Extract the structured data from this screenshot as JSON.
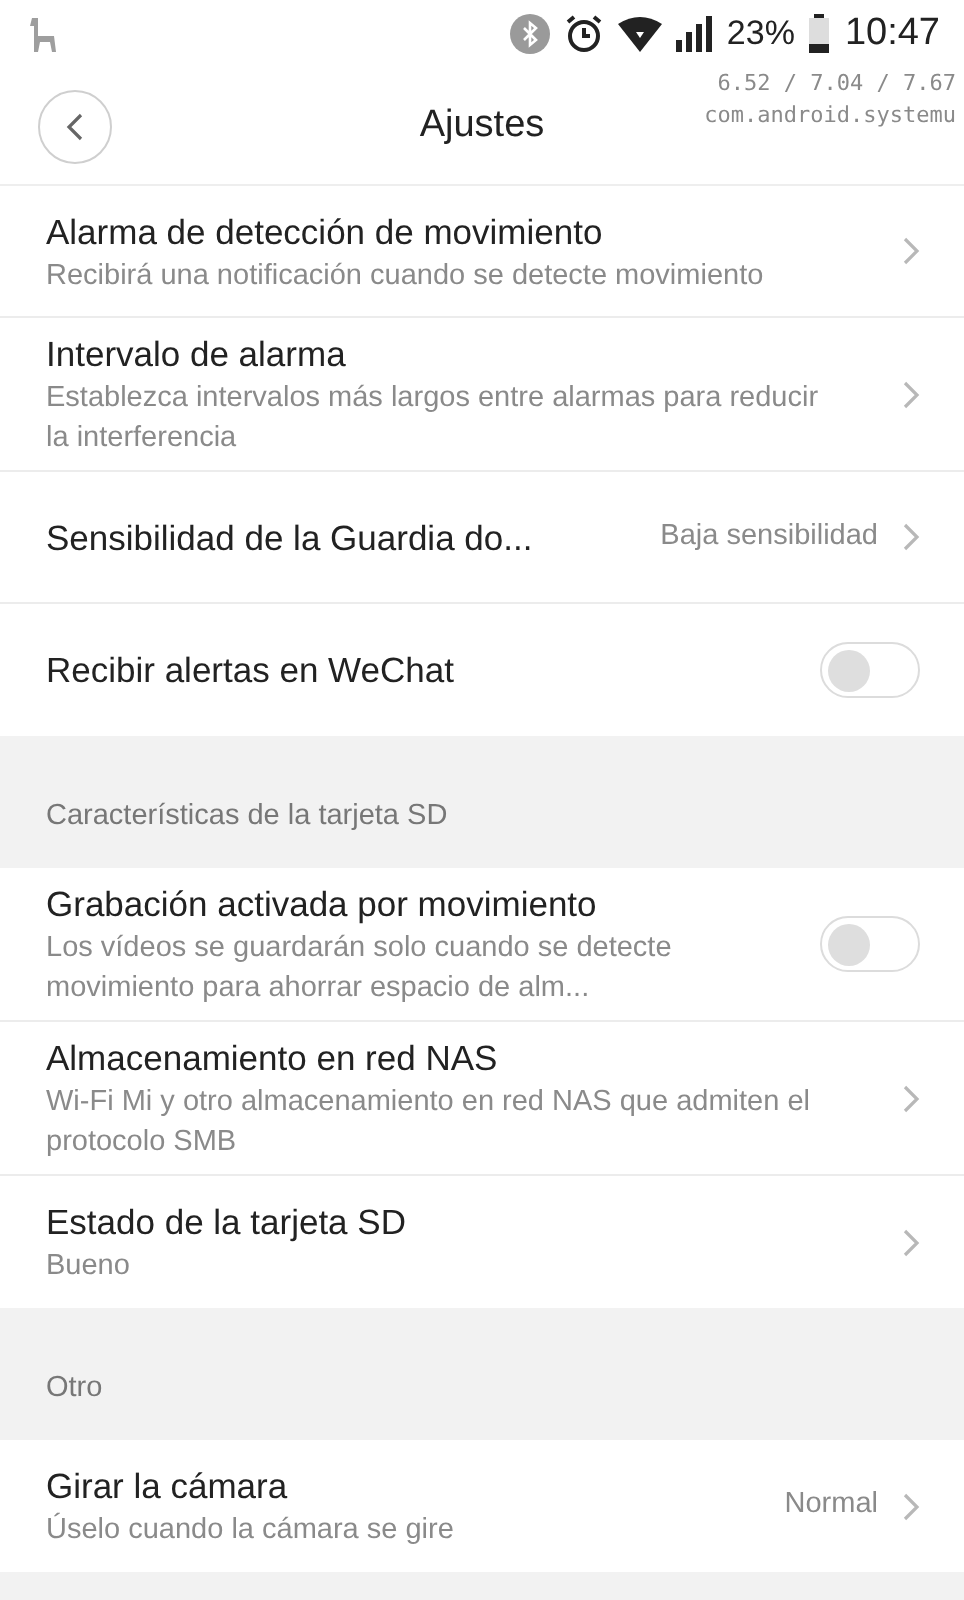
{
  "status_bar": {
    "battery": "23%",
    "time": "10:47"
  },
  "overlay": {
    "load": "6.52 / 7.04 / 7.67",
    "process": "com.android.systemu"
  },
  "header": {
    "title": "Ajustes"
  },
  "sections": [
    {
      "items": [
        {
          "kind": "nav",
          "title": "Alarma de detección de movimiento",
          "subtitle": "Recibirá una notificación cuando se detecte movimiento"
        },
        {
          "kind": "nav",
          "title": "Intervalo de alarma",
          "subtitle": "Establezca intervalos más largos entre alarmas para reducir la interferencia"
        },
        {
          "kind": "nav",
          "title": "Sensibilidad de la Guardia do...",
          "value": "Baja sensibilidad"
        },
        {
          "kind": "toggle",
          "title": "Recibir alertas en WeChat",
          "on": false
        }
      ]
    },
    {
      "title": "Características de la tarjeta SD",
      "items": [
        {
          "kind": "toggle",
          "title": "Grabación activada por movimiento",
          "subtitle": "Los vídeos se guardarán solo cuando se detecte movimiento para ahorrar espacio de alm...",
          "on": false
        },
        {
          "kind": "nav",
          "title": "Almacenamiento en red NAS",
          "subtitle": "Wi-Fi Mi y otro almacenamiento en red NAS que admiten el protocolo SMB"
        },
        {
          "kind": "nav",
          "title": "Estado de la tarjeta SD",
          "subtitle": "Bueno"
        }
      ]
    },
    {
      "title": "Otro",
      "items": [
        {
          "kind": "nav",
          "title": "Girar la cámara",
          "subtitle": "Úselo cuando la cámara se gire",
          "value": "Normal"
        }
      ]
    }
  ]
}
